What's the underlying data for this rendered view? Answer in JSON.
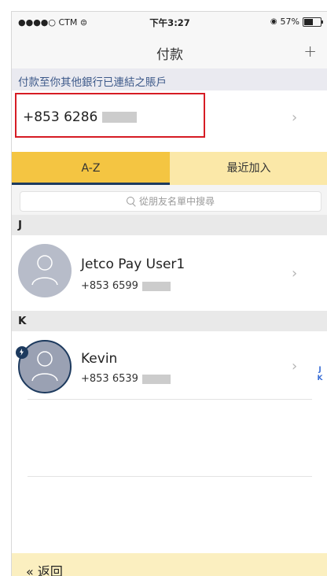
{
  "status_bar": {
    "carrier": "●●●●○ CTM ⊜",
    "time": "下午3:27",
    "battery": "57%"
  },
  "nav": {
    "title": "付款",
    "add_label": "+"
  },
  "own_account": {
    "header": "付款至你其他銀行已連結之賬戶",
    "number": "+853 6286",
    "chevron": "›"
  },
  "tabs": {
    "az": "A-Z",
    "recent": "最近加入"
  },
  "search": {
    "placeholder": "從朋友名單中搜尋"
  },
  "sections": [
    {
      "letter": "J",
      "contact": {
        "name": "Jetco Pay User1",
        "phone": "+853 6599"
      }
    },
    {
      "letter": "K",
      "contact": {
        "name": "Kevin",
        "phone": "+853 6539"
      }
    }
  ],
  "index": [
    "J",
    "K"
  ],
  "chevron": "›",
  "footer": {
    "back_label": "« 返回"
  },
  "colors": {
    "accent_yellow": "#f4c542",
    "tab_inactive": "#fbe8a8",
    "navy": "#1d3a5e",
    "highlight_red": "#d61c24"
  }
}
